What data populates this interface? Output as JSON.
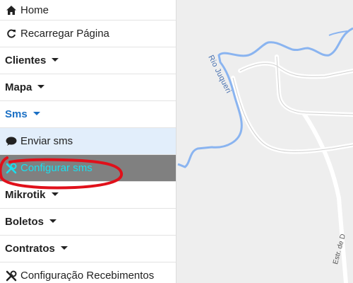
{
  "sidebar": {
    "items": [
      {
        "label": "Home",
        "icon": "home-icon"
      },
      {
        "label": "Recarregar Página",
        "icon": "reload-icon"
      },
      {
        "label": "Clientes"
      },
      {
        "label": "Mapa"
      },
      {
        "label": "Sms"
      },
      {
        "label": "Enviar sms",
        "icon": "comment-icon"
      },
      {
        "label": "Configurar sms",
        "icon": "tools-icon"
      },
      {
        "label": "Mikrotik"
      },
      {
        "label": "Boletos"
      },
      {
        "label": "Contratos"
      },
      {
        "label": "Configuração Recebimentos",
        "icon": "tools-icon"
      }
    ]
  },
  "map": {
    "river_label": "Rio Juqueri",
    "road_label": "Estr. de D"
  },
  "colors": {
    "selected_bg": "#808080",
    "selected_text": "#19e0f0",
    "sms_active": "#1a6fc4",
    "submenu_bg": "#e2eefb",
    "annotation": "#e0101a",
    "river": "#8ab4f0"
  }
}
